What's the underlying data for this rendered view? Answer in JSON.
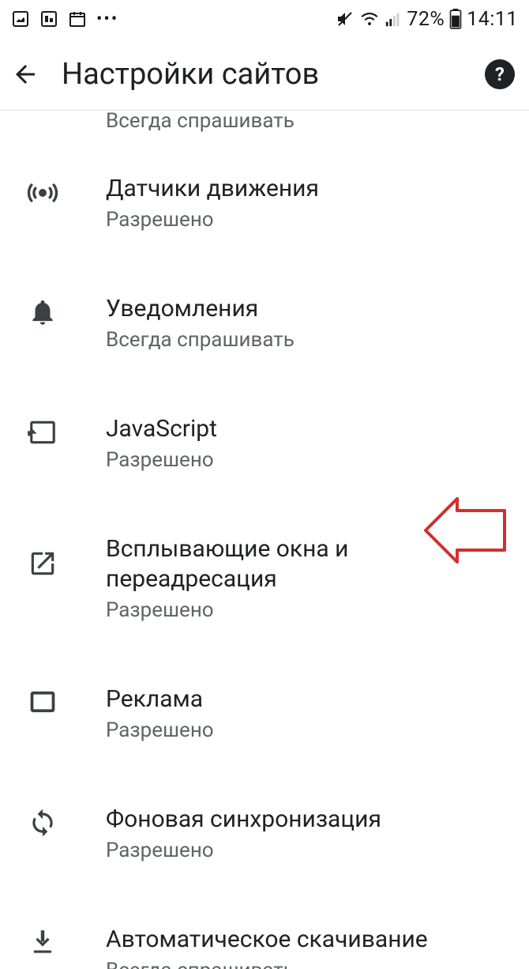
{
  "status_bar": {
    "battery_percent": "72%",
    "time": "14:11"
  },
  "app_bar": {
    "title": "Настройки сайтов"
  },
  "partial_top_subtitle": "Всегда спрашивать",
  "items": [
    {
      "title": "Датчики движения",
      "subtitle": "Разрешено"
    },
    {
      "title": "Уведомления",
      "subtitle": "Всегда спрашивать"
    },
    {
      "title": "JavaScript",
      "subtitle": "Разрешено"
    },
    {
      "title": "Всплывающие окна и переадресация",
      "subtitle": "Разрешено"
    },
    {
      "title": "Реклама",
      "subtitle": "Разрешено"
    },
    {
      "title": "Фоновая синхронизация",
      "subtitle": "Разрешено"
    }
  ],
  "partial_bottom": {
    "title": "Автоматическое скачивание",
    "subtitle": "Всегда спрашивать"
  }
}
